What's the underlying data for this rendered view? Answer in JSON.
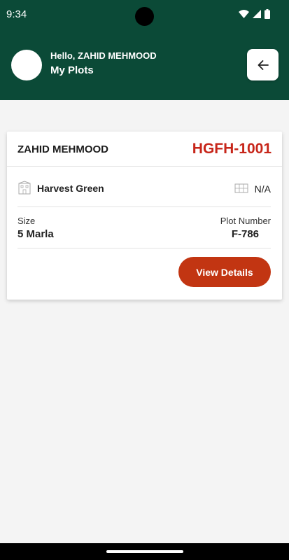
{
  "status_bar": {
    "time": "9:34"
  },
  "header": {
    "greeting": "Hello, ZAHID MEHMOOD",
    "title": "My Plots"
  },
  "card": {
    "owner": "ZAHID MEHMOOD",
    "code": "HGFH-1001",
    "project": "Harvest Green",
    "status": "N/A",
    "size_label": "Size",
    "size_value": "5 Marla",
    "plot_label": "Plot Number",
    "plot_value": "F-786",
    "button_label": "View Details"
  },
  "icons": {
    "back": "arrow-left-icon",
    "project": "building-icon",
    "status": "plot-map-icon",
    "wifi": "wifi-icon",
    "signal": "signal-icon",
    "battery": "battery-icon"
  },
  "colors": {
    "header_bg": "#0b4a37",
    "accent_red": "#c7261a",
    "button_bg": "#c23512",
    "page_bg": "#f4f4f4"
  }
}
